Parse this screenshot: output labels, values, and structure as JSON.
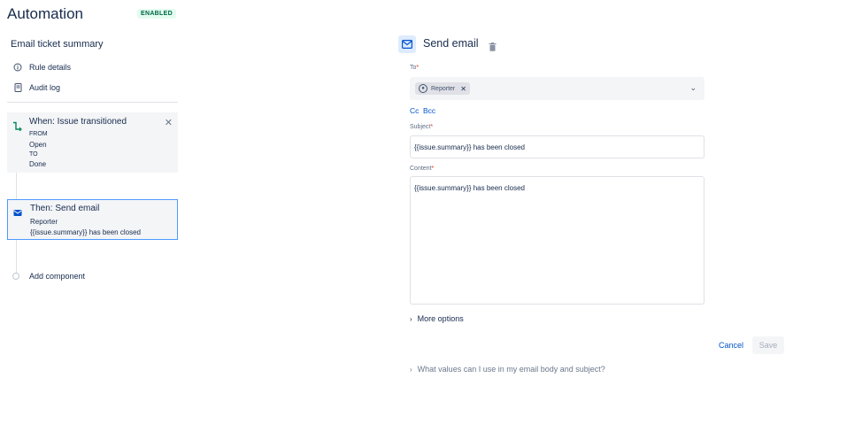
{
  "header": {
    "title": "Automation",
    "status_badge": "ENABLED"
  },
  "sidebar": {
    "rule_name": "Email ticket summary",
    "links": [
      {
        "label": "Rule details",
        "icon": "info-icon"
      },
      {
        "label": "Audit log",
        "icon": "document-icon"
      }
    ],
    "trigger": {
      "title": "When: Issue transitioned",
      "from_label": "FROM",
      "from_value": "Open",
      "to_label": "TO",
      "to_value": "Done"
    },
    "action": {
      "title": "Then: Send email",
      "recipient": "Reporter",
      "subject": "{{issue.summary}} has been closed"
    },
    "add_component": "Add component"
  },
  "panel": {
    "title": "Send email",
    "to_label": "To",
    "to_chip": "Reporter",
    "cc_label": "Cc",
    "bcc_label": "Bcc",
    "subject_label": "Subject",
    "subject_value": "{{issue.summary}} has been closed",
    "content_label": "Content",
    "content_value": "{{issue.summary}} has been closed",
    "more_options": "More options",
    "cancel": "Cancel",
    "save": "Save",
    "help": "What values can I use in my email body and subject?"
  },
  "colors": {
    "accent": "#0052cc",
    "badge_text": "#006644",
    "badge_bg": "#e3fcef",
    "selected_border": "#4c9aff",
    "required": "#de350b"
  }
}
